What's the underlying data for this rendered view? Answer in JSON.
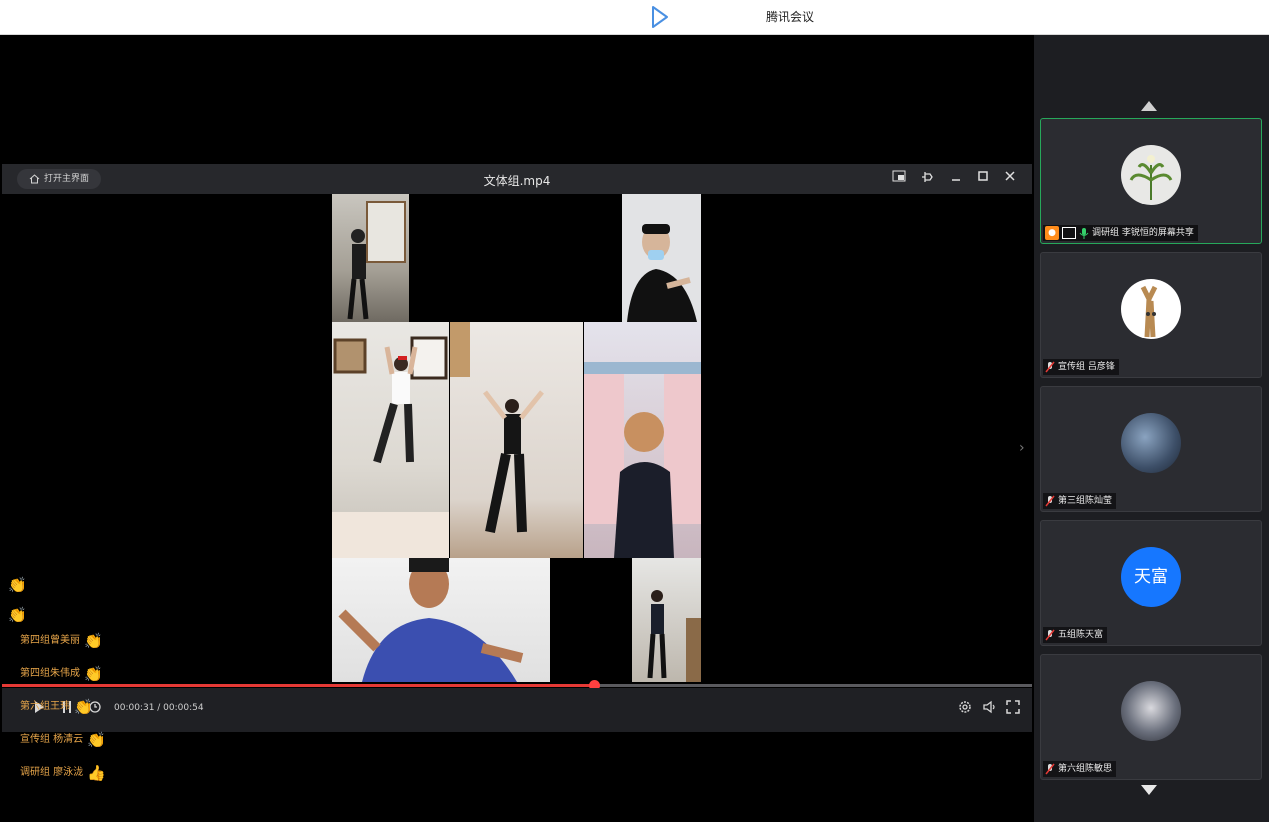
{
  "window": {
    "title": "腾讯会议"
  },
  "player": {
    "open_main_label": "打开主界面",
    "file_title": "文体组.mp4",
    "time": "00:00:31 / 00:00:54",
    "progress": 0.575
  },
  "participants": [
    {
      "name": "调研组 李锐恒的屏幕共享",
      "active": true,
      "avatar": "flower-avatar"
    },
    {
      "name": "宣传组 吕彦锋",
      "active": false,
      "avatar": "tree-avatar"
    },
    {
      "name": "第三组陈灿莹",
      "active": false,
      "avatar": "photo-avatar"
    },
    {
      "name": "五组陈天富",
      "active": false,
      "avatar_text": "天富",
      "avatar_color": "#1677ff"
    },
    {
      "name": "第六组陈敏思",
      "active": false,
      "avatar": "photo-avatar"
    }
  ],
  "chat": [
    {
      "text": "第四组曾美丽",
      "emoji": "clap"
    },
    {
      "text": "第四组朱伟成",
      "emoji": "clap"
    },
    {
      "text": "第六组王玮",
      "emoji": "clap"
    },
    {
      "text": "宣传组 杨清云",
      "emoji": "clap"
    },
    {
      "text": "调研组 廖泳泷",
      "emoji": "thumbs-up"
    }
  ],
  "colors": {
    "accent": "#e53935",
    "active_border": "#27a85b",
    "chat_text": "#e8a64a"
  }
}
